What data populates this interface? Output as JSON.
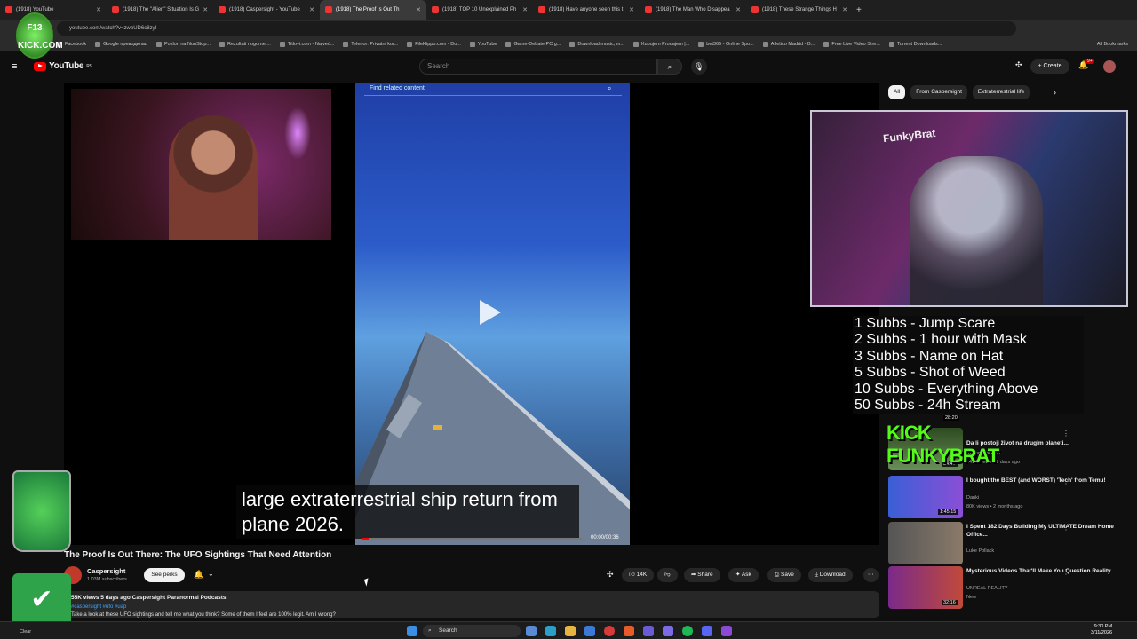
{
  "browser": {
    "tabs": [
      {
        "label": "(1918) YouTube"
      },
      {
        "label": "(1918) The \"Alien\" Situation Is G"
      },
      {
        "label": "(1918) Caspersight - YouTube"
      },
      {
        "label": "(1918) The Proof Is Out Th"
      },
      {
        "label": "(1918) TOP 10 Unexplained Ph"
      },
      {
        "label": "(1918) Have anyone seen this t"
      },
      {
        "label": "(1918) The Man Who Disappea"
      },
      {
        "label": "(1918) These Strange Things H"
      }
    ],
    "url": "youtube.com/watch?v=zwbUD6c8zyI",
    "bookmarks": [
      "Facebook",
      "Google преводилац",
      "Poklon na NonStop...",
      "Rezultati nogomet...",
      "Titlovi.com - Najveć...",
      "Telenor: Privatni kor...",
      "FileHippo.com - Do...",
      "YouTube",
      "Game-Debate PC g...",
      "Download music, m...",
      "Kupujem Prodajem |...",
      "bet365 - Online Spo...",
      "Atletico Madrid - B...",
      "Free Live Video Stre...",
      "Torrent Downloads..."
    ],
    "all_bookmarks": "All Bookmarks"
  },
  "youtube": {
    "logo": "YouTube",
    "logo_region": "RS",
    "search_placeholder": "Search",
    "create_label": "Create",
    "notif_count": "9+"
  },
  "player": {
    "find_related": "Find related content",
    "caption_line1": "large extraterrestrial ship return from",
    "caption_line2": "plane 2026.",
    "timecode": "00:00/00:36",
    "progress": 0.03
  },
  "stream_overlay": {
    "sub_goals": [
      "1 Subbs - Jump Scare",
      "2 Subbs - 1 hour with Mask",
      "3 Subbs - Name on Hat",
      "5 Subbs - Shot of Weed",
      "10 Subbs - Everything Above",
      "50 Subbs - 24h Stream"
    ],
    "kick_logo_text": "F13 KICK.COM",
    "cam_sign": "FunkyBrat",
    "kick_banner": "KICK FUNKYBRAT"
  },
  "chips": [
    "All",
    "From Caspersight",
    "Extraterrestrial life"
  ],
  "recommended": [
    {
      "title": "",
      "channel": "",
      "meta": "",
      "duration": "28:20"
    },
    {
      "title": "Da li postoji život na drugim planeti...",
      "channel": "Robert Dacešin",
      "meta": "141K views • 7 days ago",
      "duration": "34:47"
    },
    {
      "title": "I bought the BEST (and WORST) 'Tech' from Temu!",
      "channel": "Danki",
      "meta": "80K views • 2 months ago",
      "duration": "1:45:15"
    },
    {
      "title": "I Spent 182 Days Building My ULTIMATE Dream Home Office...",
      "channel": "Luke Pollack",
      "meta": "",
      "duration": ""
    },
    {
      "title": "Mysterious Videos That'll Make You Question Reality",
      "channel": "UNREAL REALITY",
      "meta": "New",
      "duration": "32:16"
    }
  ],
  "video": {
    "title": "The Proof Is Out There: The UFO Sightings That Need Attention",
    "channel": "Caspersight",
    "subscribers": "1.03M subscribers",
    "perks_label": "See perks",
    "likes": "14K",
    "share_label": "Share",
    "ask_label": "Ask",
    "save_label": "Save",
    "download_label": "Download",
    "views_date": "55K views  5 days ago  Caspersight Paranormal Podcasts",
    "tags": "#caspersight #ufo #uap",
    "description": "Take a look at these UFO sightings and tell me what you think? Some of them I feel are 100% legit. Am I wrong?"
  },
  "taskbar": {
    "search_label": "Search",
    "time": "9:30 PM",
    "date": "3/11/2026",
    "weather": "Clear"
  }
}
